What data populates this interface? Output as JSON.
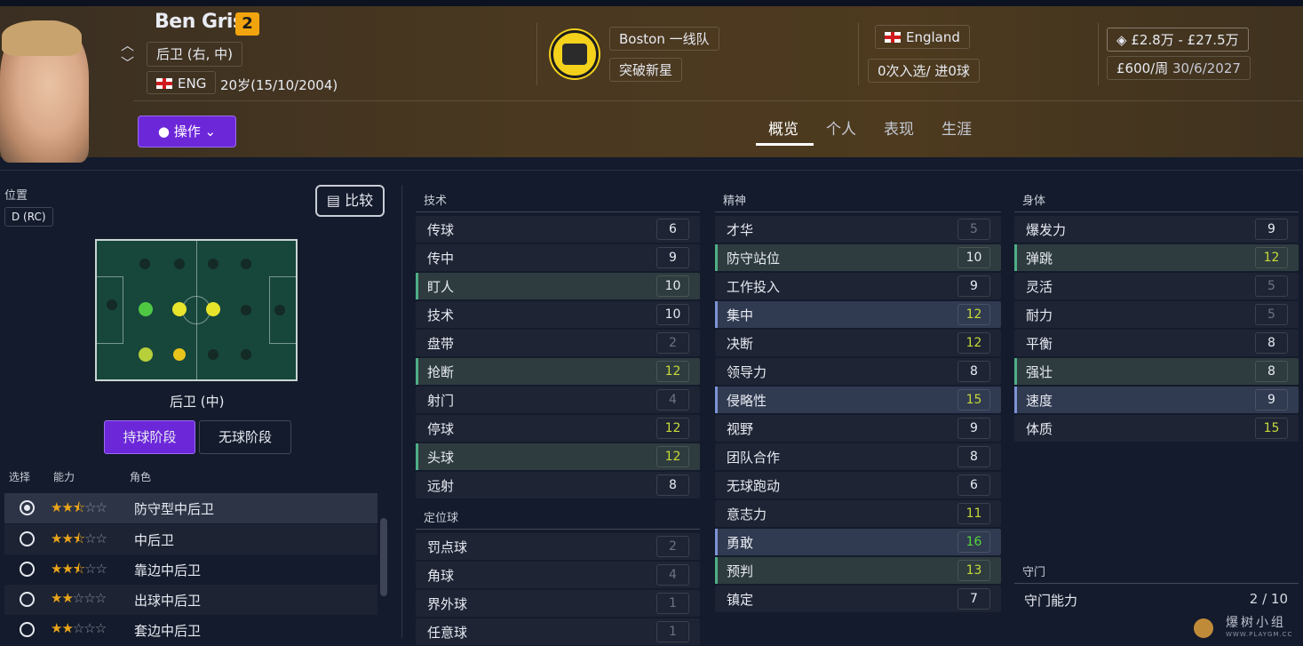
{
  "player": {
    "name": "Ben Grist",
    "number": "2",
    "position": "后卫 (右, 中)",
    "nationality": "ENG",
    "age_dob": "20岁(15/10/2004)",
    "action_label": "操作"
  },
  "club": {
    "name": "Boston 一线队",
    "status": "突破新星"
  },
  "nation": {
    "name": "England",
    "caps": "0次入选/ 进0球"
  },
  "contract": {
    "value": "£2.8万 - £27.5万",
    "wage": "£600/周",
    "expiry": "30/6/2027"
  },
  "tabs": [
    "概览",
    "个人",
    "表现",
    "生涯"
  ],
  "position_panel": {
    "label": "位置",
    "badge": "D (RC)",
    "compare": "比较",
    "selected_pos": "后卫 (中)",
    "phase_in": "持球阶段",
    "phase_out": "无球阶段",
    "head_select": "选择",
    "head_ability": "能力",
    "head_role": "角色"
  },
  "roles": [
    {
      "name": "防守型中后卫",
      "stars": 2.5
    },
    {
      "name": "中后卫",
      "stars": 2.5
    },
    {
      "name": "靠边中后卫",
      "stars": 2.5
    },
    {
      "name": "出球中后卫",
      "stars": 2
    },
    {
      "name": "套边中后卫",
      "stars": 2
    }
  ],
  "attributes": {
    "technical_title": "技术",
    "technical": [
      {
        "name": "传球",
        "value": "6"
      },
      {
        "name": "传中",
        "value": "9"
      },
      {
        "name": "盯人",
        "value": "10"
      },
      {
        "name": "技术",
        "value": "10"
      },
      {
        "name": "盘带",
        "value": "2"
      },
      {
        "name": "抢断",
        "value": "12"
      },
      {
        "name": "射门",
        "value": "4"
      },
      {
        "name": "停球",
        "value": "12"
      },
      {
        "name": "头球",
        "value": "12"
      },
      {
        "name": "远射",
        "value": "8"
      }
    ],
    "setpiece_title": "定位球",
    "setpiece": [
      {
        "name": "罚点球",
        "value": "2"
      },
      {
        "name": "角球",
        "value": "4"
      },
      {
        "name": "界外球",
        "value": "1"
      },
      {
        "name": "任意球",
        "value": "1"
      }
    ],
    "mental_title": "精神",
    "mental": [
      {
        "name": "才华",
        "value": "5"
      },
      {
        "name": "防守站位",
        "value": "10"
      },
      {
        "name": "工作投入",
        "value": "9"
      },
      {
        "name": "集中",
        "value": "12"
      },
      {
        "name": "决断",
        "value": "12"
      },
      {
        "name": "领导力",
        "value": "8"
      },
      {
        "name": "侵略性",
        "value": "15"
      },
      {
        "name": "视野",
        "value": "9"
      },
      {
        "name": "团队合作",
        "value": "8"
      },
      {
        "name": "无球跑动",
        "value": "6"
      },
      {
        "name": "意志力",
        "value": "11"
      },
      {
        "name": "勇敢",
        "value": "16"
      },
      {
        "name": "预判",
        "value": "13"
      },
      {
        "name": "镇定",
        "value": "7"
      }
    ],
    "physical_title": "身体",
    "physical": [
      {
        "name": "爆发力",
        "value": "9"
      },
      {
        "name": "弹跳",
        "value": "12"
      },
      {
        "name": "灵活",
        "value": "5"
      },
      {
        "name": "耐力",
        "value": "5"
      },
      {
        "name": "平衡",
        "value": "8"
      },
      {
        "name": "强壮",
        "value": "8"
      },
      {
        "name": "速度",
        "value": "9"
      },
      {
        "name": "体质",
        "value": "15"
      }
    ],
    "gk_title": "守门",
    "gk_label": "守门能力",
    "gk_value": "2 / 10"
  },
  "colors": {
    "accent": "#6c27d9",
    "number_badge": "#f2a40f",
    "value_low": "#6e7381",
    "value_mid": "#e8ebf2",
    "value_good": "#c6d93a",
    "value_great": "#56d83a"
  },
  "watermark": {
    "text": "爆树小组",
    "sub": "WWW.PLAYGM.CC"
  }
}
